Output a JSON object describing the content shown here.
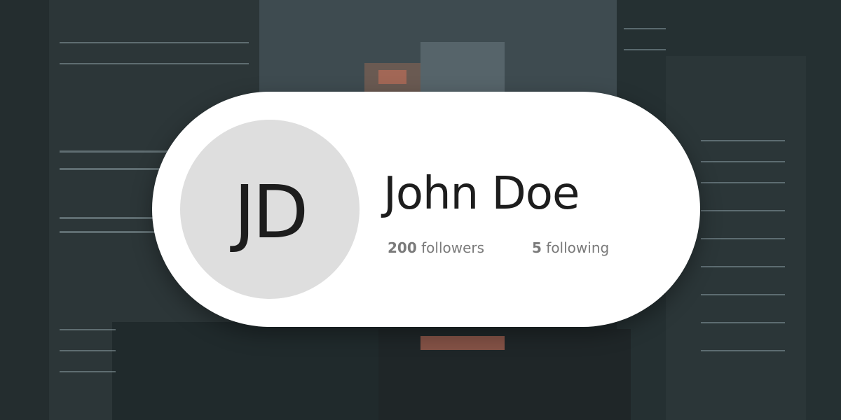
{
  "profile": {
    "initials": "JD",
    "name": "John Doe",
    "followers_count": "200",
    "followers_label": "followers",
    "following_count": "5",
    "following_label": "following"
  },
  "colors": {
    "card_bg": "#ffffff",
    "avatar_bg": "#dedede",
    "text_primary": "#1d1d1d",
    "text_secondary": "#7a7a7a"
  }
}
